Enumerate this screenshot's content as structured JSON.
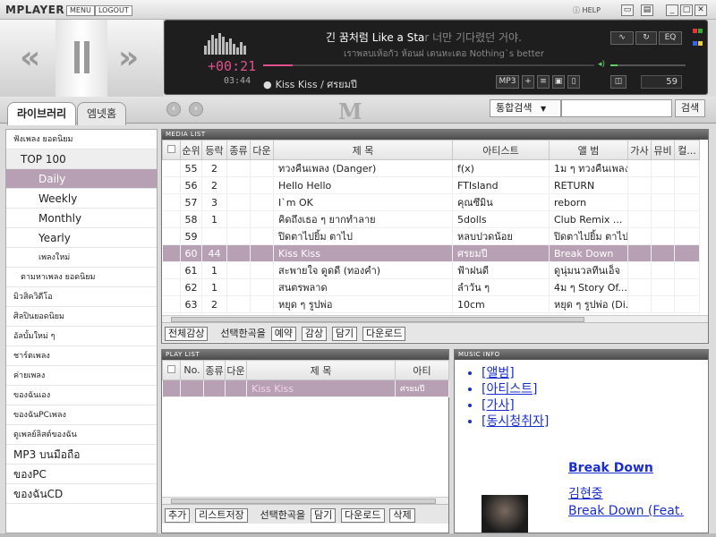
{
  "app": {
    "title": "MPLAYER",
    "menu_label": "MENU",
    "logout_label": "LOGOUT",
    "help_label": "HELP"
  },
  "player": {
    "elapsed": "+00:21",
    "total": "03:44",
    "lyric_main_start": "긴 꿈처럼 Like a Sta",
    "lyric_main_end": "r 너만 기다렸던 거야.",
    "lyric_sub": "เราพลบเห้อกัว ห้อนฝ เดนหะเดอ Nothing`s better",
    "now_playing": "Kiss Kiss / ศรยมปี",
    "progress": 0.09,
    "format_label": "MP3",
    "eq_label": "EQ",
    "volume": "59",
    "volume_level": 0.1
  },
  "tabs": [
    {
      "label": "라이브러리"
    },
    {
      "label": "엠넷홈"
    }
  ],
  "search": {
    "type_label": "통합검색",
    "button_label": "검색",
    "value": ""
  },
  "sidebar": {
    "items": [
      {
        "label": "ฟังเพลง ยอดนิยม",
        "cls": "small",
        "indent": 8
      },
      {
        "label": "TOP 100",
        "cls": "sub",
        "indent": 16
      },
      {
        "label": "Daily",
        "cls": "sel",
        "indent": 36
      },
      {
        "label": "Weekly",
        "cls": "",
        "indent": 36
      },
      {
        "label": "Monthly",
        "cls": "",
        "indent": 36
      },
      {
        "label": "Yearly",
        "cls": "",
        "indent": 36
      },
      {
        "label": "เพลงใหม่",
        "cls": "small",
        "indent": 36
      },
      {
        "label": "ตามหาเพลง ยอดนิยม",
        "cls": "small",
        "indent": 16
      },
      {
        "label": "มิวสิควิดีโอ",
        "cls": "small",
        "indent": 8
      },
      {
        "label": "ศิลปินยอดนิยม",
        "cls": "small",
        "indent": 8
      },
      {
        "label": "อัลบั้มใหม่ ๆ",
        "cls": "small",
        "indent": 8
      },
      {
        "label": "ชาร์ตเพลง",
        "cls": "small",
        "indent": 8
      },
      {
        "label": "ค่ายเพลง",
        "cls": "small",
        "indent": 8
      },
      {
        "label": "ของฉันเอง",
        "cls": "small",
        "indent": 8
      },
      {
        "label": "ของฉันPCเพลง",
        "cls": "small",
        "indent": 8
      },
      {
        "label": "ดูเพลย์ลิสต์ของฉัน",
        "cls": "small",
        "indent": 8
      },
      {
        "label": "MP3 บนมือถือ",
        "cls": "",
        "indent": 8
      },
      {
        "label": "ของPC",
        "cls": "",
        "indent": 8
      },
      {
        "label": "ของฉันCD",
        "cls": "",
        "indent": 8
      }
    ]
  },
  "media_list": {
    "title": "MEDIA LIST",
    "columns": [
      "순위",
      "등락",
      "종류",
      "다운",
      "제 목",
      "아티스트",
      "앨 범",
      "가사",
      "뮤비",
      "컬..."
    ],
    "rows": [
      {
        "rank": "55",
        "change": "2",
        "title": "ทวงคืนเพลง (Danger)",
        "artist": "f(x)",
        "album": "1ม ๆ ทวงคืนเพลง",
        "selected": false
      },
      {
        "rank": "56",
        "change": "2",
        "title": "Hello Hello",
        "artist": "FTIsland",
        "album": "RETURN",
        "selected": false
      },
      {
        "rank": "57",
        "change": "3",
        "title": "I`m OK",
        "artist": "คุณซึมิน",
        "album": "reborn",
        "selected": false
      },
      {
        "rank": "58",
        "change": "1",
        "title": "คิดถึงเธอ ๆ ยากทำลาย",
        "artist": "5dolls",
        "album": "Club Remix ...",
        "selected": false
      },
      {
        "rank": "59",
        "change": "",
        "title": "ปิดตาไปยิ้ม ตาไป",
        "artist": "หลบปวดน้อย",
        "album": "ปิดตาไปยิ้ม ตาไป",
        "selected": false
      },
      {
        "rank": "60",
        "change": "44",
        "title": "Kiss Kiss",
        "artist": "ศรยมปี",
        "album": "Break Down",
        "selected": true
      },
      {
        "rank": "61",
        "change": "1",
        "title": "สะพายใจ ดูดดี (ทองคำ)",
        "artist": "ฟ้าฝนดี",
        "album": "ดูนุ่มนวลทีนเอ็จ",
        "selected": false
      },
      {
        "rank": "62",
        "change": "1",
        "title": "สนตรพลาด",
        "artist": "ลำวัน ๆ",
        "album": "4ม ๆ Story Of...",
        "selected": false
      },
      {
        "rank": "63",
        "change": "2",
        "title": "หยุด ๆ รูปพ่อ",
        "artist": "10cm",
        "album": "หยุด ๆ รูปพ่อ (Di...",
        "selected": false
      }
    ],
    "buttons": {
      "listen_all": "전체감상",
      "selected_label": "선택한곡을",
      "reserve": "예약",
      "listen": "감상",
      "add": "담기",
      "download": "다운로드"
    }
  },
  "play_list": {
    "title": "PLAY LIST",
    "columns": [
      "No.",
      "종류",
      "다운",
      "제 목",
      "아티"
    ],
    "rows": [
      {
        "title": "Kiss Kiss",
        "artist": "ศรยมปี"
      }
    ],
    "buttons": {
      "add": "추가",
      "save_list": "리스트저장",
      "selected_label": "선택한곡을",
      "collect": "담기",
      "download": "다운로드",
      "delete": "삭제"
    }
  },
  "music_info": {
    "title": "MUSIC INFO",
    "links": [
      "[앨범]",
      "[아티스트]",
      "[가사]",
      "[동시청취자]"
    ],
    "album_title": "Break Down",
    "artist": "김현중",
    "track": "Break Down (Feat."
  }
}
